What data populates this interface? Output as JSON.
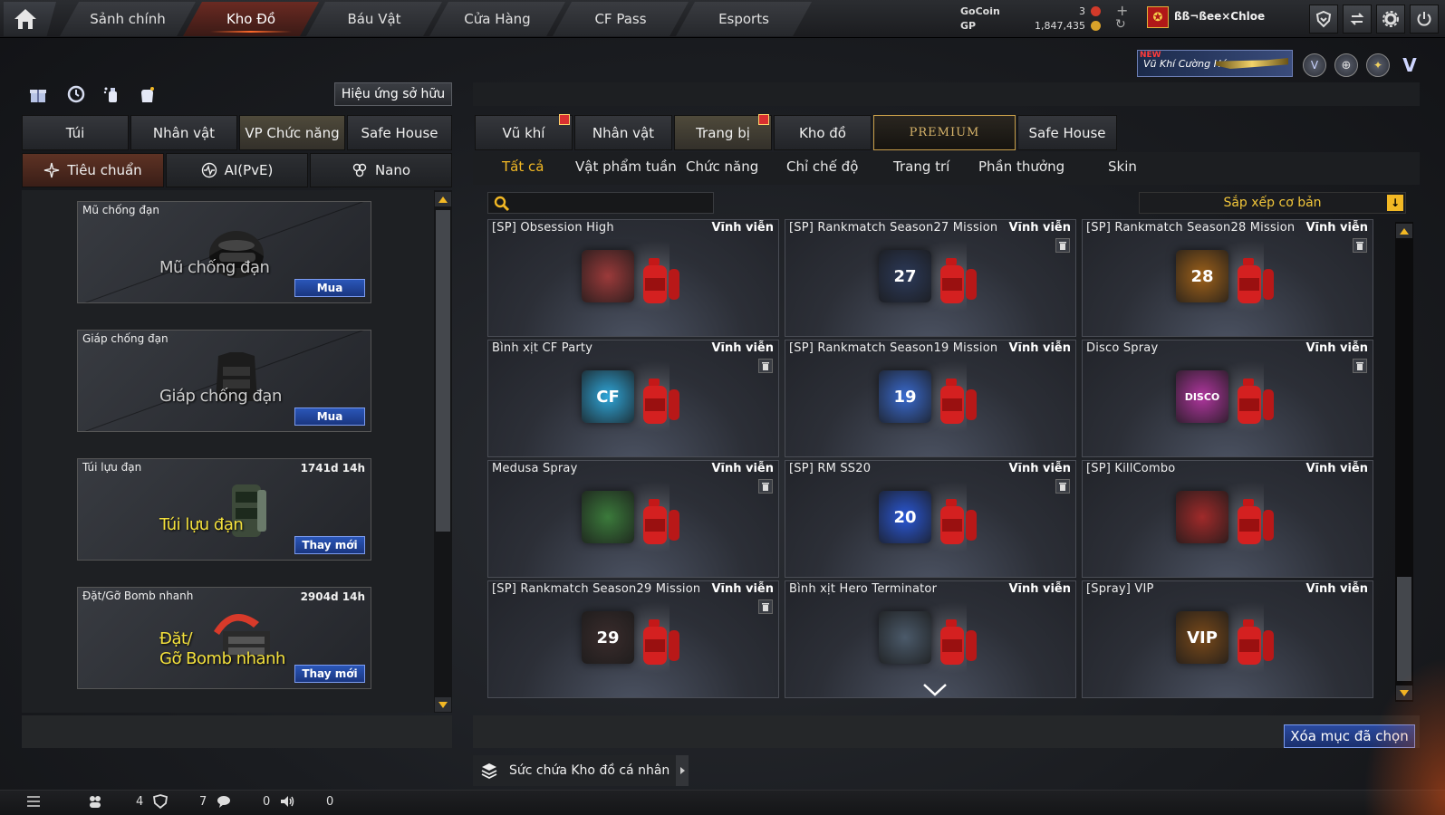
{
  "topnav": {
    "tabs": [
      {
        "label": "Sảnh chính"
      },
      {
        "label": "Kho Đồ"
      },
      {
        "label": "Báu Vật"
      },
      {
        "label": "Cửa Hàng"
      },
      {
        "label": "CF Pass"
      },
      {
        "label": "Esports"
      }
    ],
    "active_tab": "Kho Đồ"
  },
  "currency": {
    "gocoin_label": "GoCoin",
    "gocoin_value": "3",
    "gp_label": "GP",
    "gp_value": "1,847,435"
  },
  "player": {
    "name": "ßß¬ßee×Chloe"
  },
  "banner": {
    "new_label": "NEW",
    "text": "Vũ Khí Cường Hóa"
  },
  "left": {
    "effect_button": "Hiệu ứng sở hữu",
    "tabs": [
      "Túi",
      "Nhân vật",
      "VP Chức năng",
      "Safe House"
    ],
    "subtabs": [
      "Tiêu chuẩn",
      "AI(PvE)",
      "Nano"
    ],
    "items": [
      {
        "name": "Mũ chống đạn",
        "time": "",
        "caption": "Mũ chống đạn",
        "action": "Mua"
      },
      {
        "name": "Giáp chống đạn",
        "time": "",
        "caption": "Giáp chống đạn",
        "action": "Mua"
      },
      {
        "name": "Túi lựu đạn",
        "time": "1741d 14h",
        "caption": "Túi lựu đạn",
        "action": "Thay mới"
      },
      {
        "name": "Đặt/Gỡ Bomb nhanh",
        "time": "2904d 14h",
        "caption": "Đặt/",
        "caption2": "Gỡ Bomb nhanh",
        "action": "Thay mới"
      }
    ]
  },
  "right": {
    "tabs": [
      "Vũ khí",
      "Nhân vật",
      "Trang bị",
      "Kho đồ",
      "PREMIUM",
      "Safe House"
    ],
    "subtabs": [
      "Tất cả",
      "Vật phẩm tuần",
      "Chức năng",
      "Chỉ chế độ",
      "Trang trí",
      "Phần thưởng",
      "Skin"
    ],
    "sort_label": "Sắp xếp cơ bản",
    "delete_button": "Xóa mục đã chọn",
    "capacity_label": "Sức chứa Kho đồ cá nhân",
    "cards": [
      {
        "name": "[SP] Obsession High",
        "duration": "Vĩnh viễn",
        "icon_text": "",
        "color": "#9b3a3a"
      },
      {
        "name": "[SP] Rankmatch Season27 Mission",
        "duration": "Vĩnh viễn",
        "icon_text": "27",
        "color": "#2c3a5a"
      },
      {
        "name": "[SP] Rankmatch Season28 Mission",
        "duration": "Vĩnh viễn",
        "icon_text": "28",
        "color": "#a0621a"
      },
      {
        "name": "Bình xịt CF Party",
        "duration": "Vĩnh viễn",
        "icon_text": "CF",
        "color": "#2fa6d9"
      },
      {
        "name": "[SP] Rankmatch Season19 Mission",
        "duration": "Vĩnh viễn",
        "icon_text": "19",
        "color": "#3a6bd0"
      },
      {
        "name": "Disco Spray",
        "duration": "Vĩnh viễn",
        "icon_text": "DISCO",
        "color": "#b0369f"
      },
      {
        "name": "Medusa Spray",
        "duration": "Vĩnh viễn",
        "icon_text": "",
        "color": "#3b7a3b"
      },
      {
        "name": "[SP] RM SS20",
        "duration": "Vĩnh viễn",
        "icon_text": "20",
        "color": "#2a58d8"
      },
      {
        "name": "[SP] KillCombo",
        "duration": "Vĩnh viễn",
        "icon_text": "",
        "color": "#a02a2a"
      },
      {
        "name": "[SP] Rankmatch Season29 Mission",
        "duration": "Vĩnh viễn",
        "icon_text": "29",
        "color": "#3a2c2c"
      },
      {
        "name": "Bình xịt Hero Terminator",
        "duration": "Vĩnh viễn",
        "icon_text": "",
        "color": "#4b5a6a"
      },
      {
        "name": "[Spray] VIP",
        "duration": "Vĩnh viễn",
        "icon_text": "VIP",
        "color": "#7a4a1a"
      }
    ]
  },
  "statusbar": {
    "friends": "4",
    "clan": "7",
    "chat": "0",
    "voice": "0"
  },
  "colors": {
    "accent": "#f2b824",
    "button_blue": "#2a4aa0",
    "active_red": "#6a2a22"
  }
}
